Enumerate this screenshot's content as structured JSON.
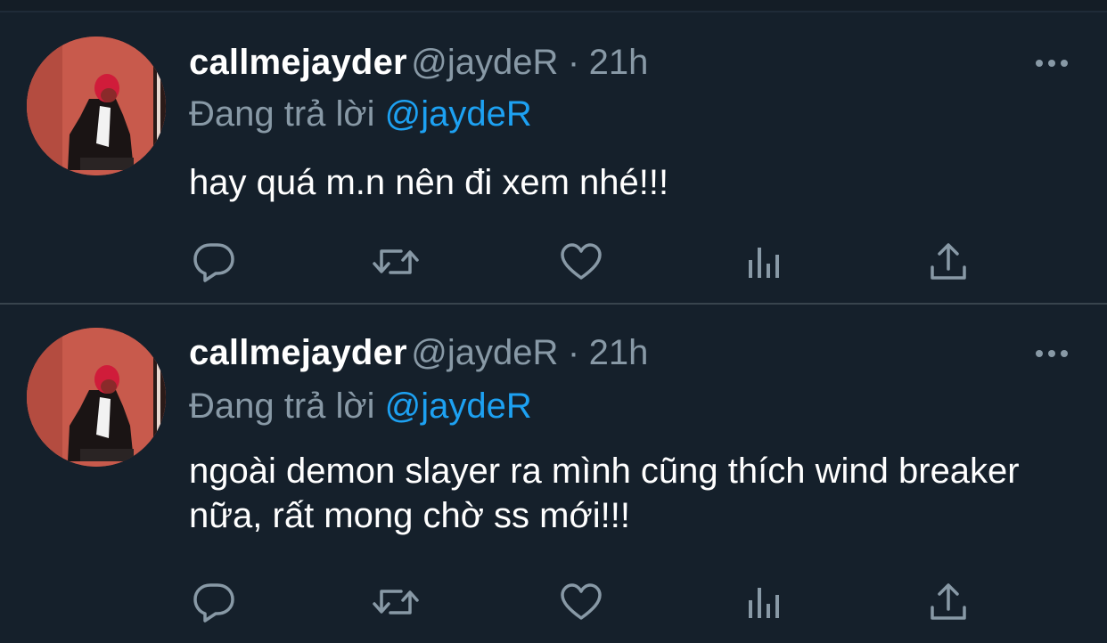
{
  "tweets": [
    {
      "display_name": "callmejayder",
      "handle": "@jaydeR",
      "separator": "·",
      "time": "21h",
      "reply_prefix": "Đang trả lời",
      "reply_to": "@jaydeR",
      "text": "hay quá m.n nên đi xem nhé!!!",
      "avatar_icon": "profile-photo"
    },
    {
      "display_name": "callmejayder",
      "handle": "@jaydeR",
      "separator": "·",
      "time": "21h",
      "reply_prefix": "Đang trả lời",
      "reply_to": "@jaydeR",
      "text": "ngoài demon slayer ra mình cũng thích wind breaker nữa, rất mong chờ ss mới!!!",
      "avatar_icon": "profile-photo"
    }
  ],
  "icons": {
    "more": "more-icon",
    "reply": "reply-icon",
    "retweet": "retweet-icon",
    "like": "heart-icon",
    "stats": "stats-icon",
    "share": "share-icon"
  },
  "colors": {
    "background": "#15202b",
    "divider": "#38444d",
    "muted": "#8899a6",
    "link": "#1da1f2",
    "text": "#ffffff"
  }
}
